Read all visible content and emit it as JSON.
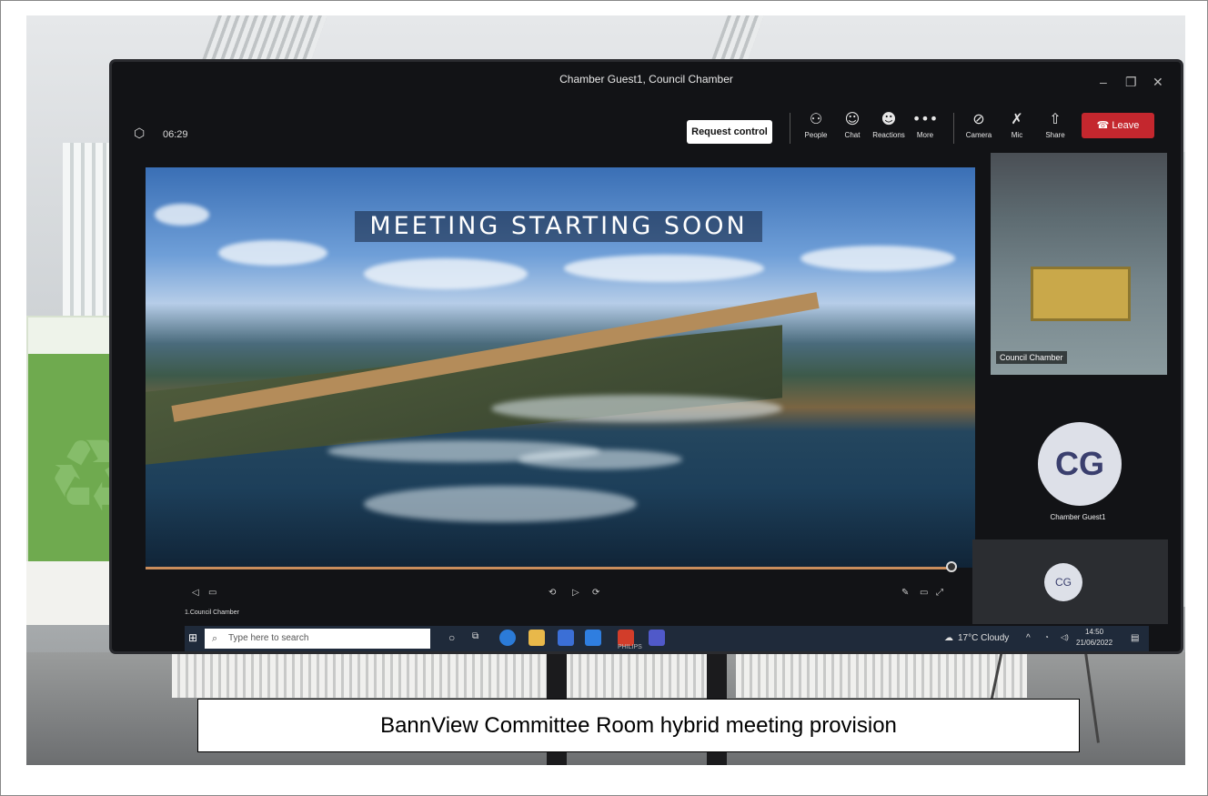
{
  "caption": "BannView Committee Room hybrid meeting provision",
  "teams": {
    "window_title": "Chamber Guest1, Council Chamber",
    "timer": "06:29",
    "request_control_label": "Request control",
    "toolbar": {
      "people": "People",
      "chat": "Chat",
      "reactions": "Reactions",
      "more": "More",
      "camera": "Camera",
      "mic": "Mic",
      "share": "Share",
      "leave": "Leave"
    },
    "shared_content_banner": "MEETING STARTING SOON",
    "participants": {
      "video_tile_label": "Council Chamber",
      "guest_initials": "CG",
      "guest_name": "Chamber Guest1",
      "self_initials": "CG"
    }
  },
  "taskbar": {
    "search_placeholder": "Type here to search",
    "weather": "17°C  Cloudy",
    "time": "14:50",
    "date": "21/06/2022",
    "mini_app_label": "1.Council Chamber",
    "monitor_brand": "PHILIPS"
  },
  "icons": [
    "shield-icon",
    "people-icon",
    "chat-icon",
    "reactions-icon",
    "more-icon",
    "camera-off-icon",
    "mic-off-icon",
    "share-icon",
    "phone-icon",
    "search-icon",
    "windows-icon"
  ],
  "colors": {
    "leave": "#c4272e",
    "seek": "#c98d5c",
    "taskbar": "#1f2a3a"
  }
}
